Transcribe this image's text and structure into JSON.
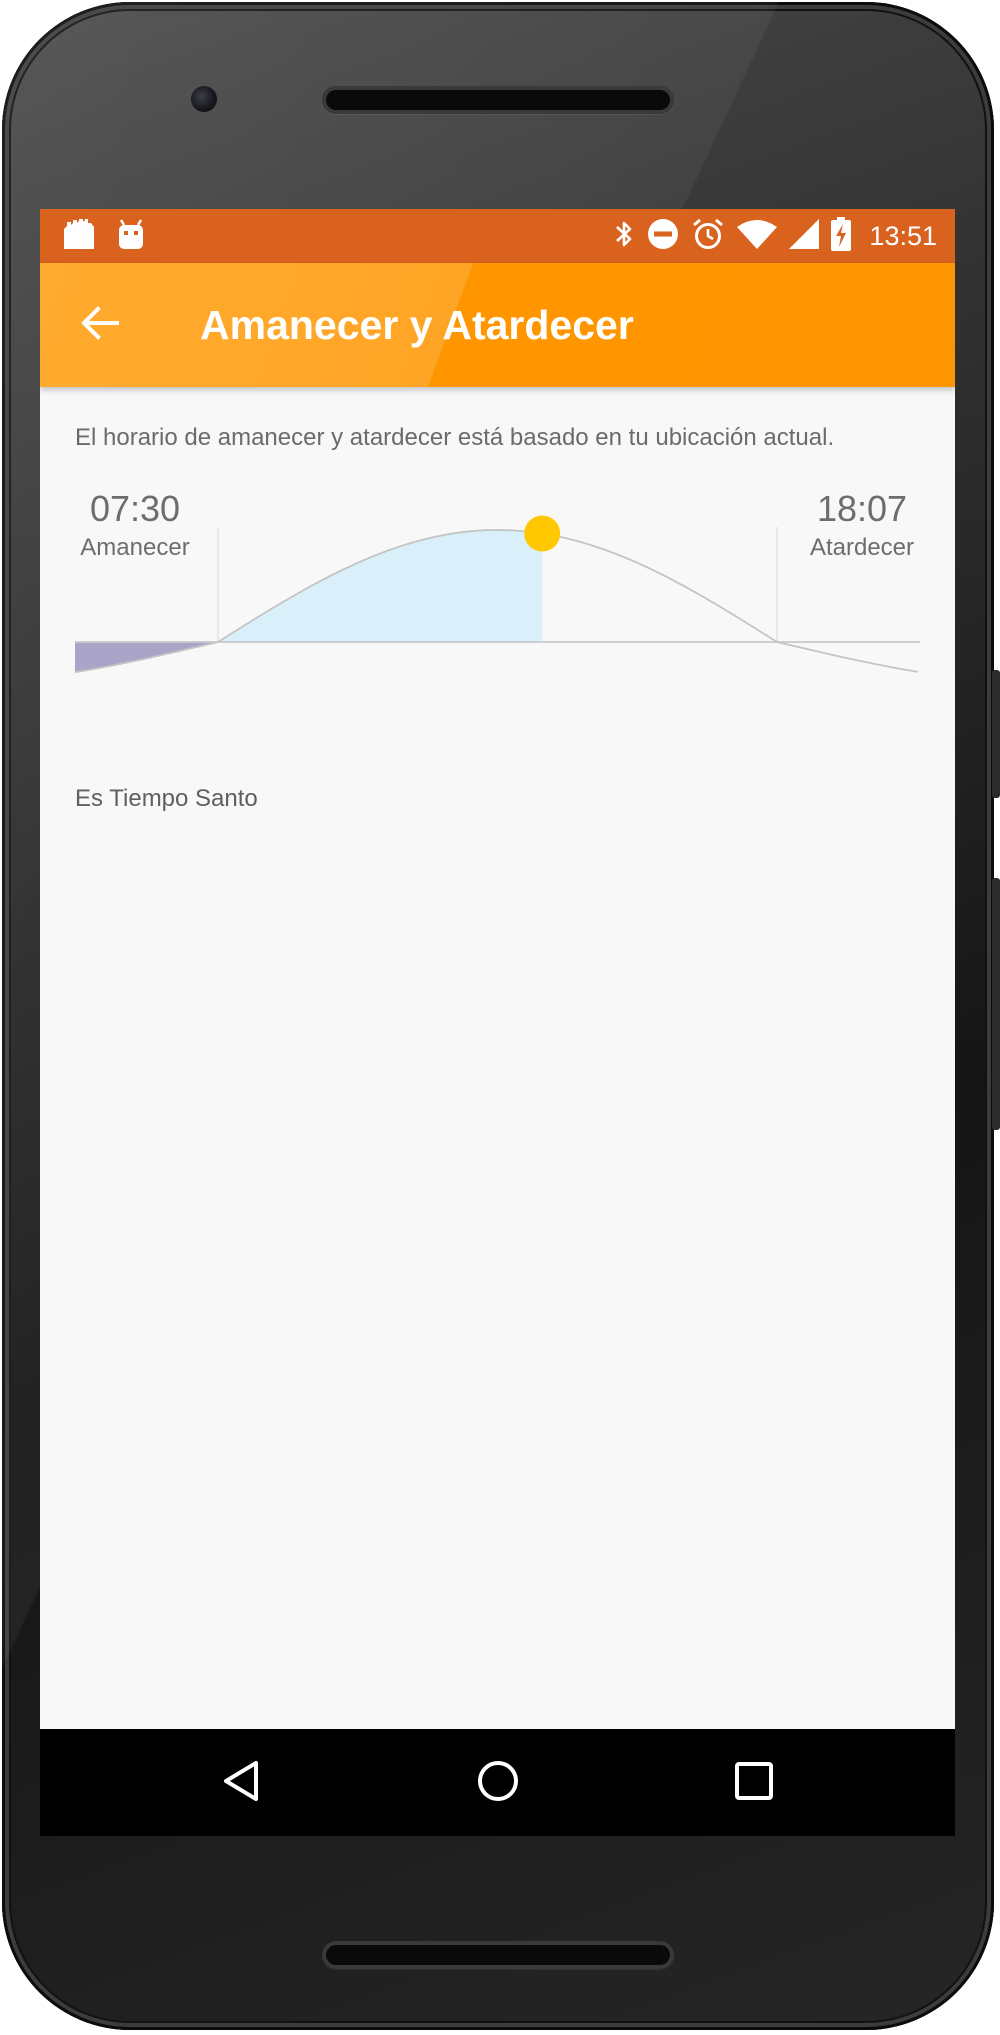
{
  "status_bar": {
    "time": "13:51",
    "notification_icons": [
      "sdcard-notification-icon",
      "android-debug-icon"
    ],
    "system_icons": [
      "bluetooth-icon",
      "do-not-disturb-icon",
      "alarm-icon",
      "wifi-icon",
      "cell-signal-icon",
      "battery-charging-icon"
    ],
    "color": "#d9621f"
  },
  "app_bar": {
    "title": "Amanecer y Atardecer",
    "back_icon": "arrow-back-icon",
    "color": "#ff9800"
  },
  "main": {
    "description": "El horario de amanecer y atardecer está basado en tu ubicación actual.",
    "sunrise": {
      "time": "07:30",
      "label": "Amanecer"
    },
    "sunset": {
      "time": "18:07",
      "label": "Atardecer"
    },
    "sun_progress": 0.58,
    "footer_text": "Es Tiempo Santo",
    "colors": {
      "daylight_fill": "#d9f0fa",
      "night_fill": "#aaa5c8",
      "sun": "#ffc800",
      "curve": "#c4c4c4"
    }
  },
  "nav_bar": {
    "back_icon": "nav-back-icon",
    "home_icon": "nav-home-icon",
    "recents_icon": "nav-recents-icon"
  }
}
